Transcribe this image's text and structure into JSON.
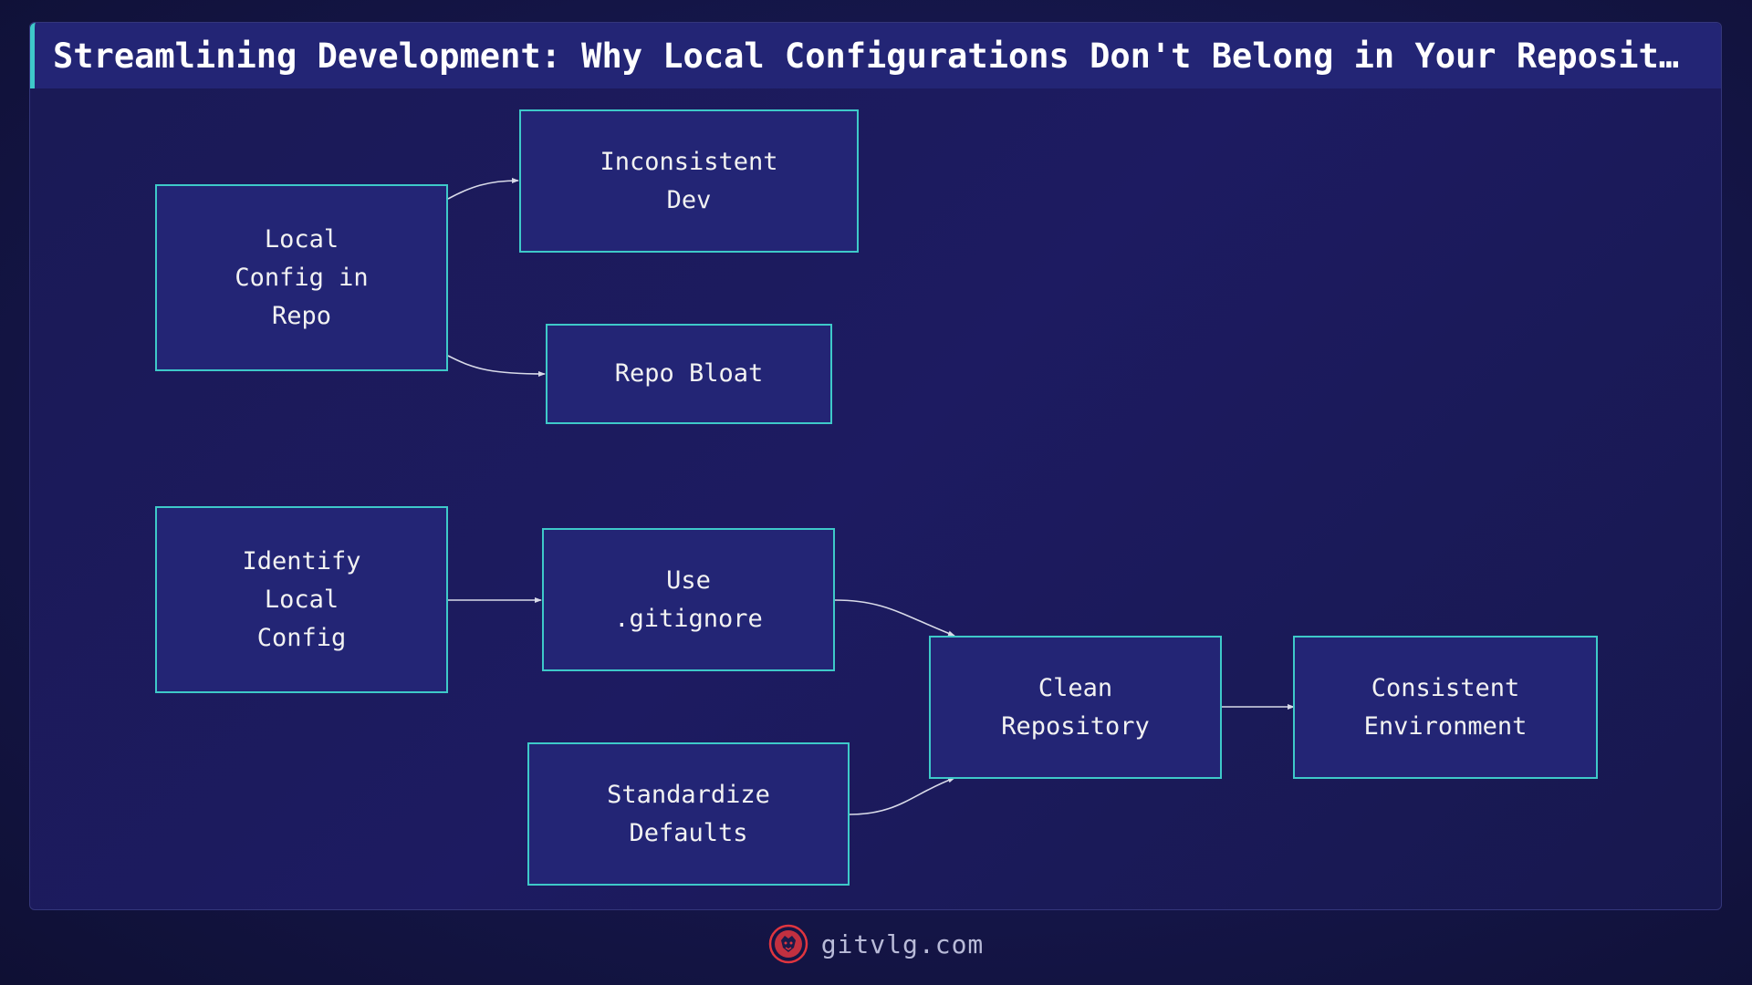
{
  "title": "Streamlining Development: Why Local Configurations Don't Belong in Your Reposit…",
  "colors": {
    "node_fill": "#232575",
    "node_border": "#3ec9c9",
    "connector": "#d8dae8",
    "accent": "#3ec9c9",
    "logo": "#e0353f"
  },
  "nodes": {
    "local_config_in_repo": "Local\nConfig in\nRepo",
    "inconsistent_dev": "Inconsistent\nDev",
    "repo_bloat": "Repo Bloat",
    "identify_local_config": "Identify\nLocal\nConfig",
    "use_gitignore": "Use\n.gitignore",
    "standardize_defaults": "Standardize\nDefaults",
    "clean_repository": "Clean\nRepository",
    "consistent_environment": "Consistent\nEnvironment"
  },
  "edges": [
    {
      "from": "Local Config in Repo",
      "to": "Inconsistent Dev"
    },
    {
      "from": "Local Config in Repo",
      "to": "Repo Bloat"
    },
    {
      "from": "Identify Local Config",
      "to": "Use .gitignore"
    },
    {
      "from": "Use .gitignore",
      "to": "Clean Repository"
    },
    {
      "from": "Standardize Defaults",
      "to": "Clean Repository"
    },
    {
      "from": "Clean Repository",
      "to": "Consistent Environment"
    }
  ],
  "footer": {
    "site": "gitvlg.com",
    "logo_icon": "lion-head-icon"
  }
}
